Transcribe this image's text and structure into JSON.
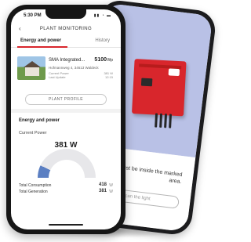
{
  "colors": {
    "accent": "#d8262c",
    "gauge": "#5b7fc2",
    "back_screen_top": "#b9c1e6"
  },
  "status_bar": {
    "time": "5:30 PM",
    "icons": "▮▮ ◔ ▬"
  },
  "nav": {
    "back_icon": "chevron-left-icon",
    "title": "PLANT MONITORING"
  },
  "tabs": [
    {
      "label": "Energy and power",
      "active": true
    },
    {
      "label": "History",
      "active": false
    }
  ],
  "plant": {
    "name": "SMA Integrated...",
    "value": "5100",
    "unit": "Wp",
    "address": "Hofmannweg 4, 34613 Waldeck",
    "meta_left": [
      "Current Power",
      "Last Update"
    ],
    "meta_right": [
      "381 W",
      "12:15"
    ]
  },
  "profile_button": "PLANT PROFILE",
  "section_title": "Energy and power",
  "current_power": {
    "label": "Current Power",
    "value": "381 W",
    "level_fraction": 0.14
  },
  "totals": [
    {
      "label": "Total Consumption",
      "value": "418",
      "unit": "W"
    },
    {
      "label": "Total Generation",
      "value": "381",
      "unit": "W"
    }
  ],
  "back_phone": {
    "message": "must be inside the marked area.",
    "button": "Scan the light"
  }
}
